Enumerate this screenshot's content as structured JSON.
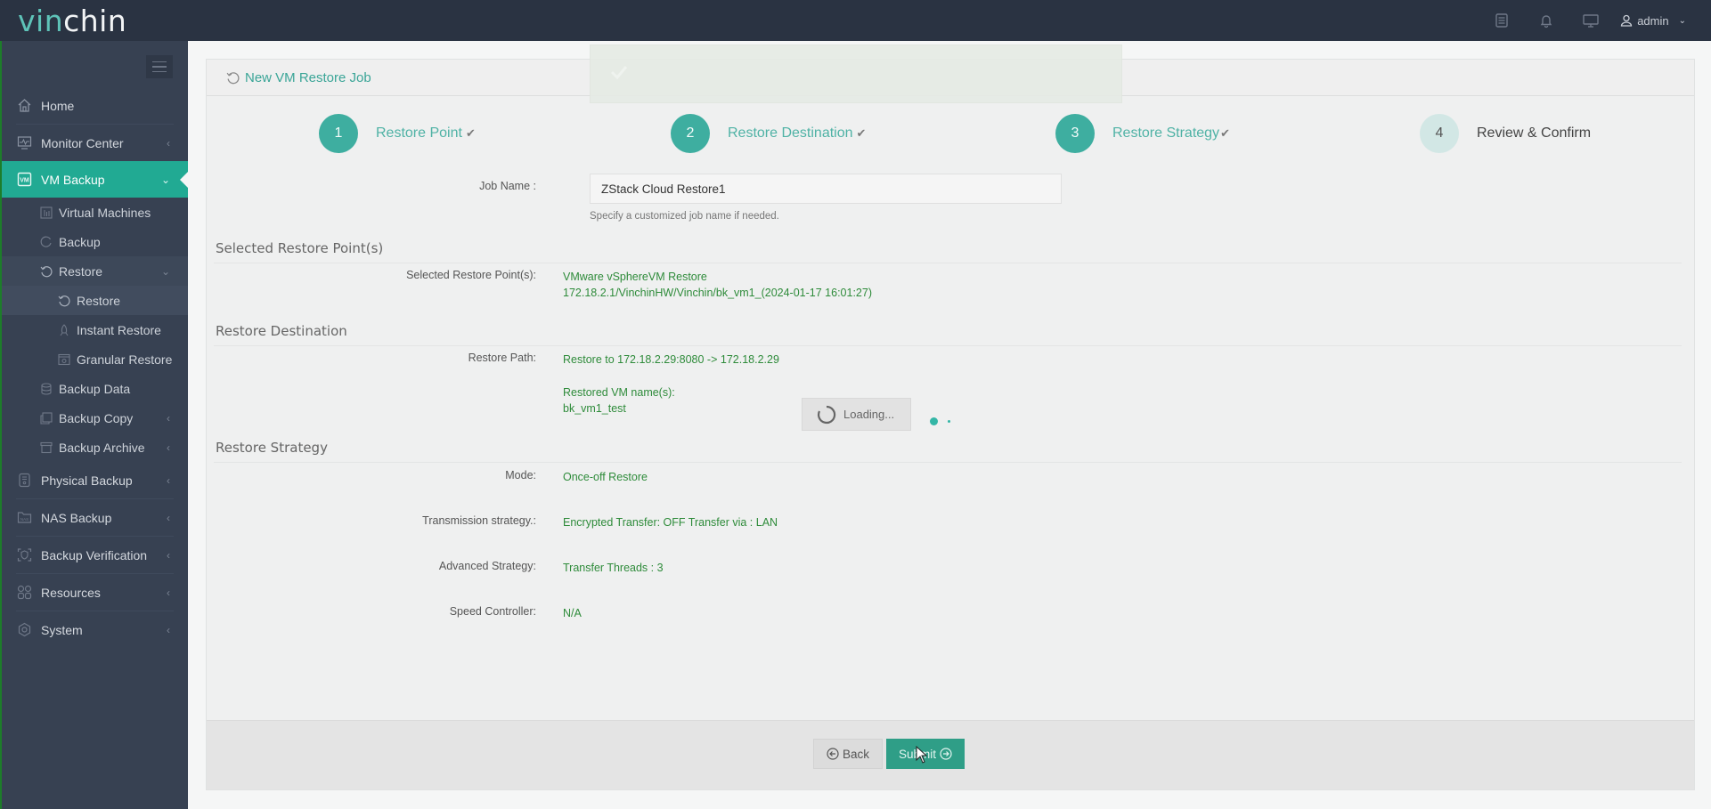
{
  "topbar": {
    "logo_part1": "vin",
    "logo_part2": "chin",
    "icons": [
      "document-list-icon",
      "bell-icon",
      "monitor-icon"
    ],
    "user_label": "admin"
  },
  "sidebar": {
    "items": [
      {
        "label": "Home",
        "icon": "home-icon"
      },
      {
        "label": "Monitor Center",
        "icon": "monitor-chart-icon"
      },
      {
        "label": "VM Backup",
        "icon": "vm-icon"
      },
      {
        "label": "Physical Backup",
        "icon": "server-icon"
      },
      {
        "label": "NAS Backup",
        "icon": "nas-icon"
      },
      {
        "label": "Backup Verification",
        "icon": "shield-scan-icon"
      },
      {
        "label": "Resources",
        "icon": "grid-icon"
      },
      {
        "label": "System",
        "icon": "gear-icon"
      }
    ],
    "vm_backup_children": [
      {
        "label": "Virtual Machines"
      },
      {
        "label": "Backup"
      },
      {
        "label": "Restore"
      },
      {
        "label": "Backup Data"
      },
      {
        "label": "Backup Copy"
      },
      {
        "label": "Backup Archive"
      }
    ],
    "restore_children": [
      {
        "label": "Restore"
      },
      {
        "label": "Instant Restore"
      },
      {
        "label": "Granular Restore"
      }
    ]
  },
  "panel": {
    "title": "New VM Restore Job",
    "steps": [
      {
        "number": "1",
        "label": "Restore Point",
        "done": true
      },
      {
        "number": "2",
        "label": "Restore Destination",
        "done": true
      },
      {
        "number": "3",
        "label": "Restore Strategy",
        "done": true
      },
      {
        "number": "4",
        "label": "Review & Confirm",
        "done": false
      }
    ],
    "job_name_label": "Job Name :",
    "job_name_value": "ZStack Cloud Restore1",
    "job_name_hint": "Specify a customized job name if needed.",
    "sections": {
      "restore_point": {
        "title": "Selected Restore Point(s)",
        "label": "Selected Restore Point(s):",
        "line1": "VMware vSphereVM Restore",
        "line2": "172.18.2.1/VinchinHW/Vinchin/bk_vm1_(2024-01-17 16:01:27)"
      },
      "destination": {
        "title": "Restore Destination",
        "path_label": "Restore Path:",
        "path_value": "Restore to 172.18.2.29:8080 -> 172.18.2.29",
        "vm_names_label": "Restored VM name(s):",
        "vm_names_value": "bk_vm1_test"
      },
      "strategy": {
        "title": "Restore Strategy",
        "rows": [
          {
            "label": "Mode:",
            "value": "Once-off Restore"
          },
          {
            "label": "Transmission strategy.:",
            "value": "Encrypted Transfer: OFF Transfer via : LAN"
          },
          {
            "label": "Advanced Strategy:",
            "value": "Transfer Threads : 3"
          },
          {
            "label": "Speed Controller:",
            "value": "N/A"
          }
        ]
      }
    },
    "loading_text": "Loading...",
    "buttons": {
      "back": "Back",
      "submit": "Submit"
    }
  },
  "colors": {
    "accent": "#21aa93",
    "topbar": "#2a3342",
    "sidebar": "#374152",
    "value_green": "#2e8b3a"
  }
}
